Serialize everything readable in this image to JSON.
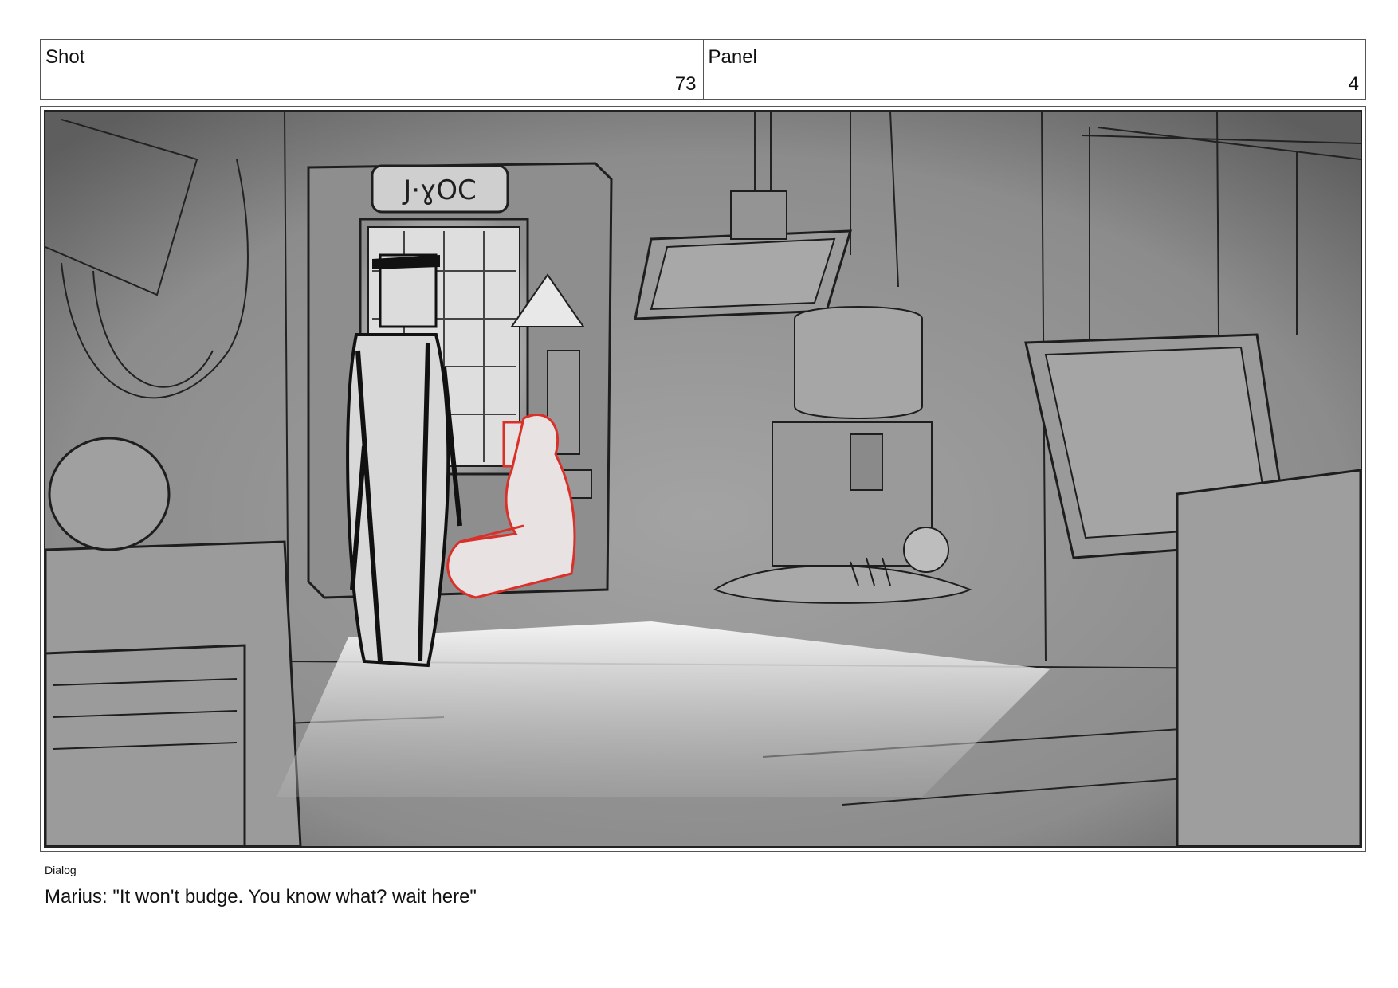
{
  "header": {
    "shot_label": "Shot",
    "shot_number": "73",
    "panel_label": "Panel",
    "panel_number": "4"
  },
  "dialog": {
    "label": "Dialog",
    "text": "Marius: \"It won't budge. You know what? wait here\""
  },
  "scene": {
    "machine_sign": "J·ɣOC",
    "colors": {
      "background": "#8f8f8f",
      "line": "#1e1e1e",
      "character_red": "#d9302a",
      "light": "#f2f2f2"
    }
  }
}
